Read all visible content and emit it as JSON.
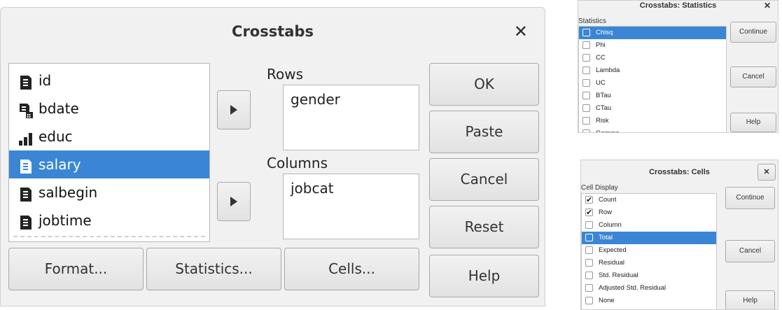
{
  "main_dialog": {
    "title": "Crosstabs",
    "close_label": "✕",
    "variables": [
      {
        "name": "id",
        "icon": "scale-doc-icon",
        "selected": false
      },
      {
        "name": "bdate",
        "icon": "date-doc-icon",
        "selected": false
      },
      {
        "name": "educ",
        "icon": "ordinal-bars-icon",
        "selected": false
      },
      {
        "name": "salary",
        "icon": "scale-doc-icon",
        "selected": true
      },
      {
        "name": "salbegin",
        "icon": "scale-doc-icon",
        "selected": false
      },
      {
        "name": "jobtime",
        "icon": "scale-doc-icon",
        "selected": false
      }
    ],
    "rows_label": "Rows",
    "rows_value": "gender",
    "columns_label": "Columns",
    "columns_value": "jobcat",
    "buttons": {
      "ok": "OK",
      "paste": "Paste",
      "cancel": "Cancel",
      "reset": "Reset",
      "help": "Help",
      "format": "Format...",
      "statistics": "Statistics...",
      "cells": "Cells..."
    }
  },
  "statistics_dialog": {
    "title": "Crosstabs: Statistics",
    "close_label": "✕",
    "header": "Statistics",
    "items": [
      {
        "label": "Chisq",
        "checked": false,
        "selected": true
      },
      {
        "label": "Phi",
        "checked": false,
        "selected": false
      },
      {
        "label": "CC",
        "checked": false,
        "selected": false
      },
      {
        "label": "Lambda",
        "checked": false,
        "selected": false
      },
      {
        "label": "UC",
        "checked": false,
        "selected": false
      },
      {
        "label": "BTau",
        "checked": false,
        "selected": false
      },
      {
        "label": "CTau",
        "checked": false,
        "selected": false
      },
      {
        "label": "Risk",
        "checked": false,
        "selected": false
      },
      {
        "label": "Gamma",
        "checked": false,
        "selected": false
      }
    ],
    "buttons": {
      "continue": "Continue",
      "cancel": "Cancel",
      "help": "Help"
    }
  },
  "cells_dialog": {
    "title": "Crosstabs: Cells",
    "close_label": "✕",
    "header": "Cell Display",
    "items": [
      {
        "label": "Count",
        "checked": true,
        "selected": false
      },
      {
        "label": "Row",
        "checked": true,
        "selected": false
      },
      {
        "label": "Column",
        "checked": false,
        "selected": false
      },
      {
        "label": "Total",
        "checked": false,
        "selected": true
      },
      {
        "label": "Expected",
        "checked": false,
        "selected": false
      },
      {
        "label": "Residual",
        "checked": false,
        "selected": false
      },
      {
        "label": "Std. Residual",
        "checked": false,
        "selected": false
      },
      {
        "label": "Adjusted Std. Residual",
        "checked": false,
        "selected": false
      },
      {
        "label": "None",
        "checked": false,
        "selected": false
      }
    ],
    "buttons": {
      "continue": "Continue",
      "cancel": "Cancel",
      "help": "Help"
    }
  },
  "colors": {
    "selection": "#3b86d4",
    "dialog_bg": "#f1f1f1"
  }
}
